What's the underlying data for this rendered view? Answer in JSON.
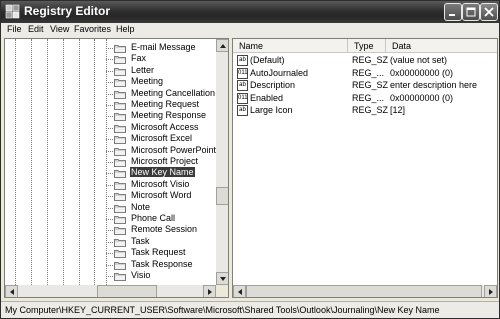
{
  "window": {
    "title": "Registry Editor"
  },
  "menu": [
    "File",
    "Edit",
    "View",
    "Favorites",
    "Help"
  ],
  "tree": {
    "items": [
      {
        "label": "E-mail Message"
      },
      {
        "label": "Fax"
      },
      {
        "label": "Letter"
      },
      {
        "label": "Meeting"
      },
      {
        "label": "Meeting Cancellation"
      },
      {
        "label": "Meeting Request"
      },
      {
        "label": "Meeting Response"
      },
      {
        "label": "Microsoft Access"
      },
      {
        "label": "Microsoft Excel"
      },
      {
        "label": "Microsoft PowerPoint"
      },
      {
        "label": "Microsoft Project"
      },
      {
        "label": "New Key Name",
        "selected": true
      },
      {
        "label": "Microsoft Visio"
      },
      {
        "label": "Microsoft Word"
      },
      {
        "label": "Note"
      },
      {
        "label": "Phone Call"
      },
      {
        "label": "Remote Session"
      },
      {
        "label": "Task"
      },
      {
        "label": "Task Request"
      },
      {
        "label": "Task Response"
      },
      {
        "label": "Visio"
      }
    ]
  },
  "list": {
    "headers": {
      "name": "Name",
      "type": "Type",
      "data": "Data"
    },
    "rows": [
      {
        "icon": "ab",
        "name": "(Default)",
        "type": "REG_SZ",
        "data": "(value not set)"
      },
      {
        "icon": "011",
        "name": "AutoJournaled",
        "type": "REG_...",
        "data": "0x00000000 (0)"
      },
      {
        "icon": "ab",
        "name": "Description",
        "type": "REG_SZ",
        "data": "enter description here"
      },
      {
        "icon": "011",
        "name": "Enabled",
        "type": "REG_...",
        "data": "0x00000000 (0)"
      },
      {
        "icon": "ab",
        "name": "Large Icon",
        "type": "REG_SZ",
        "data": "[12]"
      }
    ]
  },
  "status": {
    "path": "My Computer\\HKEY_CURRENT_USER\\Software\\Microsoft\\Shared Tools\\Outlook\\Journaling\\New Key Name"
  }
}
